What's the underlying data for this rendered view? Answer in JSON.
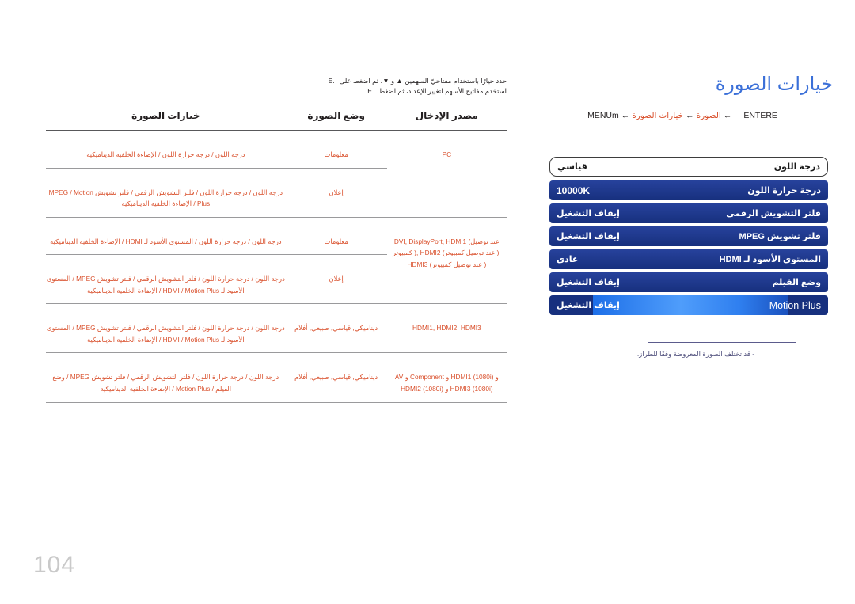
{
  "page": {
    "number": "104"
  },
  "header": {
    "title": "خيارات الصورة",
    "breadcrumb": {
      "menu_key": "MENUm",
      "arrow": "←",
      "level1": "الصورة",
      "level2": "خيارات الصورة",
      "enter_key": "ENTERE"
    }
  },
  "instructions": {
    "line1": "حدد خيارًا باستخدام مفتاحيّ السهمين ▲ و ▼، ثم اضغط على",
    "line1_key": "E.",
    "line2": "استخدم مفاتيح الأسهم لتغيير الإعداد، ثم اضغط",
    "line2_key": "E."
  },
  "osd": {
    "rows": [
      {
        "label": "درجة اللون",
        "value": "قياسي",
        "style": "first",
        "value_latin": false
      },
      {
        "label": "درجة حرارة اللون",
        "value": "10000K",
        "style": "normal",
        "value_latin": true
      },
      {
        "label": "فلتر التشويش الرقمي",
        "value": "إيقاف التشغيل",
        "style": "normal",
        "value_latin": false
      },
      {
        "label": "فلتر تشويش MPEG",
        "value": "إيقاف التشغيل",
        "style": "normal",
        "value_latin": false
      },
      {
        "label": "المستوى الأسود لـ HDMI",
        "value": "عادي",
        "style": "normal",
        "value_latin": false
      },
      {
        "label": "وضع الفيلم",
        "value": "إيقاف التشغيل",
        "style": "normal",
        "value_latin": false
      },
      {
        "label": "Motion Plus",
        "value": "إيقاف التشغيل",
        "style": "selected",
        "value_latin": false,
        "label_latin": true
      }
    ],
    "note": "- قد تختلف الصورة المعروضة وفقًا للطراز."
  },
  "table": {
    "headers": {
      "source": "مصدر الإدخال",
      "mode": "وضع الصورة",
      "options": "خيارات الصورة"
    },
    "rows": [
      {
        "source": "PC",
        "mode": "معلومات",
        "options": "درجة اللون / درجة حرارة اللون / الإضاءة الخلفية الديناميكية"
      },
      {
        "source": "",
        "mode": "إعلان",
        "options": "درجة اللون / درجة حرارة اللون / فلتر التشويش الرقمي / فلتر تشويش MPEG / Motion Plus / الإضاءة الخلفية الديناميكية"
      },
      {
        "source": "DVI, DisplayPort, HDMI1 (عند توصيل كمبيوتر ), HDMI2 (عند توصيل كمبيوتر ), HDMI3 (عند توصيل كمبيوتر )",
        "mode": "معلومات",
        "options": "درجة اللون / درجة حرارة اللون / المستوى الأسود لـ HDMI / الإضاءة الخلفية الديناميكية"
      },
      {
        "source": "",
        "mode": "إعلان",
        "options": "درجة اللون / درجة حرارة اللون / فلتر التشويش الرقمي / فلتر تشويش MPEG / المستوى الأسود لـ HDMI / Motion Plus / الإضاءة الخلفية الديناميكية"
      },
      {
        "source": "HDMI1, HDMI2, HDMI3",
        "mode": "ديناميكي, قياسي, طبيعي, أفلام",
        "options": "درجة اللون / درجة حرارة اللون / فلتر التشويش الرقمي / فلتر تشويش MPEG / المستوى الأسود لـ HDMI / Motion Plus / الإضاءة الخلفية الديناميكية"
      },
      {
        "source": "AV و Component و HDMI1 (1080i) و HDMI2 (1080i) و HDMI3 (1080i)",
        "mode": "ديناميكي, قياسي, طبيعي, أفلام",
        "options": "درجة اللون / درجة حرارة اللون / فلتر التشويش الرقمي / فلتر تشويش MPEG / وضع الفيلم / Motion Plus / الإضاءة الخلفية الديناميكية"
      }
    ]
  },
  "colors": {
    "title_blue": "#3a6fd8",
    "table_red": "#d94f2b",
    "osd_blue": "#1e3a8f",
    "osd_highlight": "#4f9dfb",
    "page_number_gray": "#c9c9c9"
  }
}
